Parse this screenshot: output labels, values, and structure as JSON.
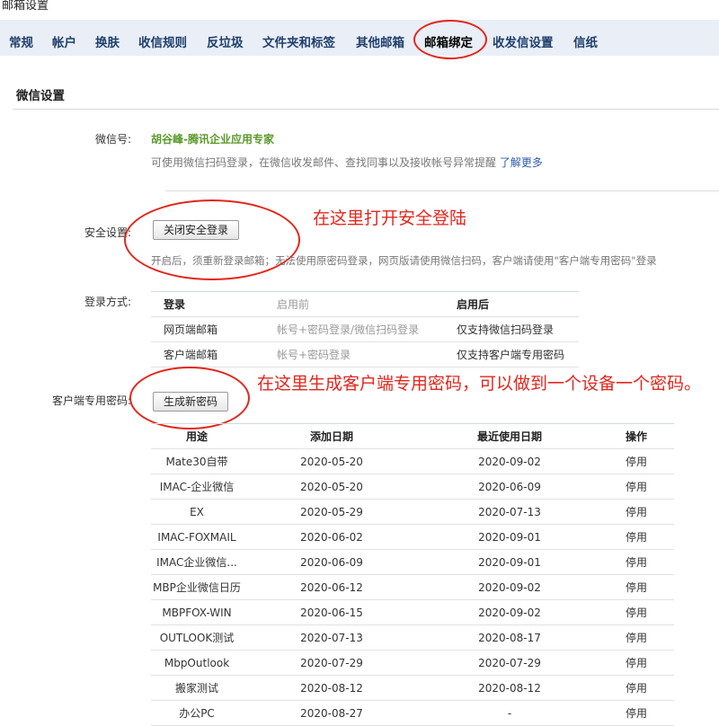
{
  "window_title": "邮箱设置",
  "tabs": [
    "常规",
    "帐户",
    "换肤",
    "收信规则",
    "反垃圾",
    "文件夹和标签",
    "其他邮箱",
    "邮箱绑定",
    "收发信设置",
    "信纸"
  ],
  "section_title": "微信设置",
  "wechat": {
    "label": "微信号:",
    "value": "胡谷峰-腾讯企业应用专家",
    "desc": "可使用微信扫码登录，在微信收发邮件、查找同事以及接收帐号异常提醒",
    "link": "了解更多"
  },
  "security": {
    "label": "安全设置:",
    "button": "关闭安全登录",
    "desc": "开启后，须重新登录邮箱；无法使用原密码登录，网页版请使用微信扫码，客户端请使用\"客户端专用密码\"登录"
  },
  "login": {
    "label": "登录方式:",
    "headers": [
      "登录",
      "启用前",
      "启用后"
    ],
    "rows": [
      [
        "网页端邮箱",
        "帐号+密码登录/微信扫码登录",
        "仅支持微信扫码登录"
      ],
      [
        "客户端邮箱",
        "帐号+密码登录",
        "仅支持客户端专用密码"
      ]
    ]
  },
  "client_password": {
    "label": "客户端专用密码:",
    "button": "生成新密码",
    "headers": [
      "用途",
      "添加日期",
      "最近使用日期",
      "操作"
    ],
    "rows": [
      [
        "Mate30自带",
        "2020-05-20",
        "2020-09-02",
        "停用"
      ],
      [
        "IMAC-企业微信",
        "2020-05-20",
        "2020-06-09",
        "停用"
      ],
      [
        "EX",
        "2020-05-29",
        "2020-07-13",
        "停用"
      ],
      [
        "IMAC-FOXMAIL",
        "2020-06-02",
        "2020-09-01",
        "停用"
      ],
      [
        "IMAC企业微信...",
        "2020-06-09",
        "2020-09-01",
        "停用"
      ],
      [
        "MBP企业微信日历",
        "2020-06-12",
        "2020-09-02",
        "停用"
      ],
      [
        "MBPFOX-WIN",
        "2020-06-15",
        "2020-09-02",
        "停用"
      ],
      [
        "OUTLOOK测试",
        "2020-07-13",
        "2020-08-17",
        "停用"
      ],
      [
        "MbpOutlook",
        "2020-07-29",
        "2020-07-29",
        "停用"
      ],
      [
        "搬家测试",
        "2020-08-12",
        "2020-08-12",
        "停用"
      ],
      [
        "办公PC",
        "2020-08-27",
        "-",
        "停用"
      ]
    ]
  },
  "annotations": {
    "security_note": "在这里打开安全登陆",
    "password_note": "在这里生成客户端专用密码，可以做到一个设备一个密码。"
  },
  "colors": {
    "tab_text": "#1f3f6b",
    "tab_bar": "#e9eef7",
    "highlight_green": "#5a9a2a",
    "link_blue": "#2a5da8",
    "annotation_red": "#e3261c"
  }
}
